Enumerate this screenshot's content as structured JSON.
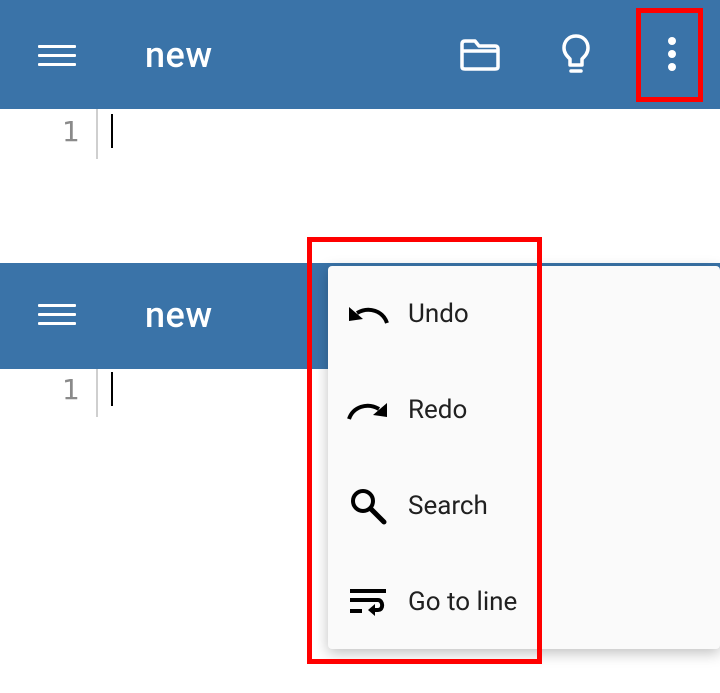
{
  "top_bar": {
    "title": "new",
    "menu_icon": "hamburger-menu-icon",
    "folder_icon": "folder-icon",
    "lightbulb_icon": "lightbulb-icon",
    "overflow_icon": "more-vert-icon"
  },
  "editor_top": {
    "line_number": "1"
  },
  "second_bar": {
    "title": "new",
    "menu_icon": "hamburger-menu-icon"
  },
  "editor_bottom": {
    "line_number": "1"
  },
  "overflow_menu": {
    "items": [
      {
        "label": "Undo",
        "icon": "undo-icon"
      },
      {
        "label": "Redo",
        "icon": "redo-icon"
      },
      {
        "label": "Search",
        "icon": "search-icon"
      },
      {
        "label": "Go to line",
        "icon": "wrap-text-icon"
      }
    ]
  },
  "colors": {
    "app_bar": "#3a73a8",
    "highlight": "#ff0000",
    "menu_bg": "#fafafa"
  }
}
